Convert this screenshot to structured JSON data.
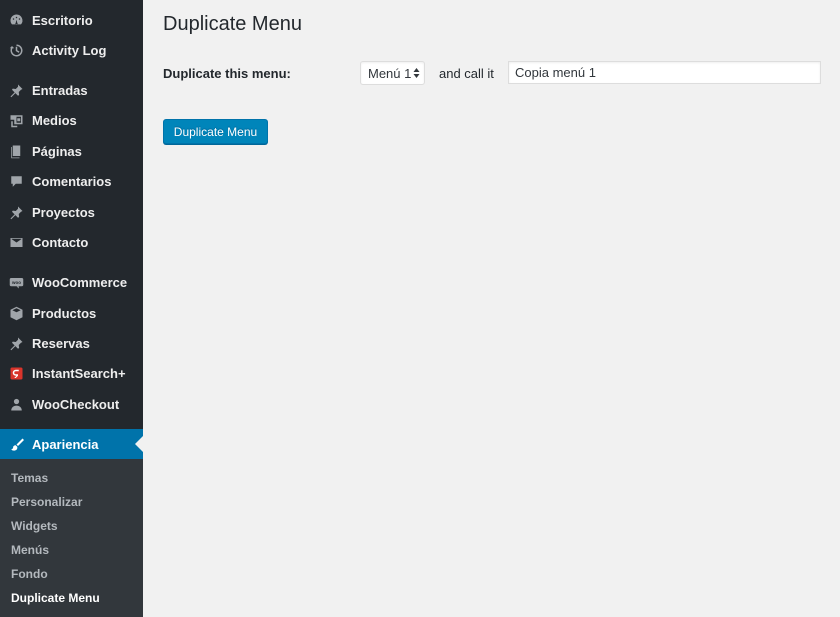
{
  "sidebar": {
    "items": [
      {
        "label": "Escritorio",
        "icon": "dashboard-icon"
      },
      {
        "label": "Activity Log",
        "icon": "history-icon"
      },
      {
        "label": "Entradas",
        "icon": "pin-icon"
      },
      {
        "label": "Medios",
        "icon": "media-icon"
      },
      {
        "label": "Páginas",
        "icon": "pages-icon"
      },
      {
        "label": "Comentarios",
        "icon": "comment-icon"
      },
      {
        "label": "Proyectos",
        "icon": "pin-icon"
      },
      {
        "label": "Contacto",
        "icon": "envelope-icon"
      },
      {
        "label": "WooCommerce",
        "icon": "woo-icon"
      },
      {
        "label": "Productos",
        "icon": "box-icon"
      },
      {
        "label": "Reservas",
        "icon": "pin-icon"
      },
      {
        "label": "InstantSearch+",
        "icon": "instantsearch-icon"
      },
      {
        "label": "WooCheckout",
        "icon": "user-icon"
      },
      {
        "label": "Apariencia",
        "icon": "brush-icon"
      }
    ],
    "submenu": [
      "Temas",
      "Personalizar",
      "Widgets",
      "Menús",
      "Fondo",
      "Duplicate Menu"
    ]
  },
  "main": {
    "title": "Duplicate Menu",
    "duplicate_label": "Duplicate this menu:",
    "selected_menu": "Menú 1",
    "call_label": "and call it",
    "new_name_value": "Copia menú 1",
    "button_label": "Duplicate Menu"
  },
  "colors": {
    "sidebar_bg": "#23282d",
    "submenu_bg": "#32373c",
    "accent": "#0073aa",
    "button": "#0085ba",
    "instantsearch_red": "#d9342b"
  }
}
